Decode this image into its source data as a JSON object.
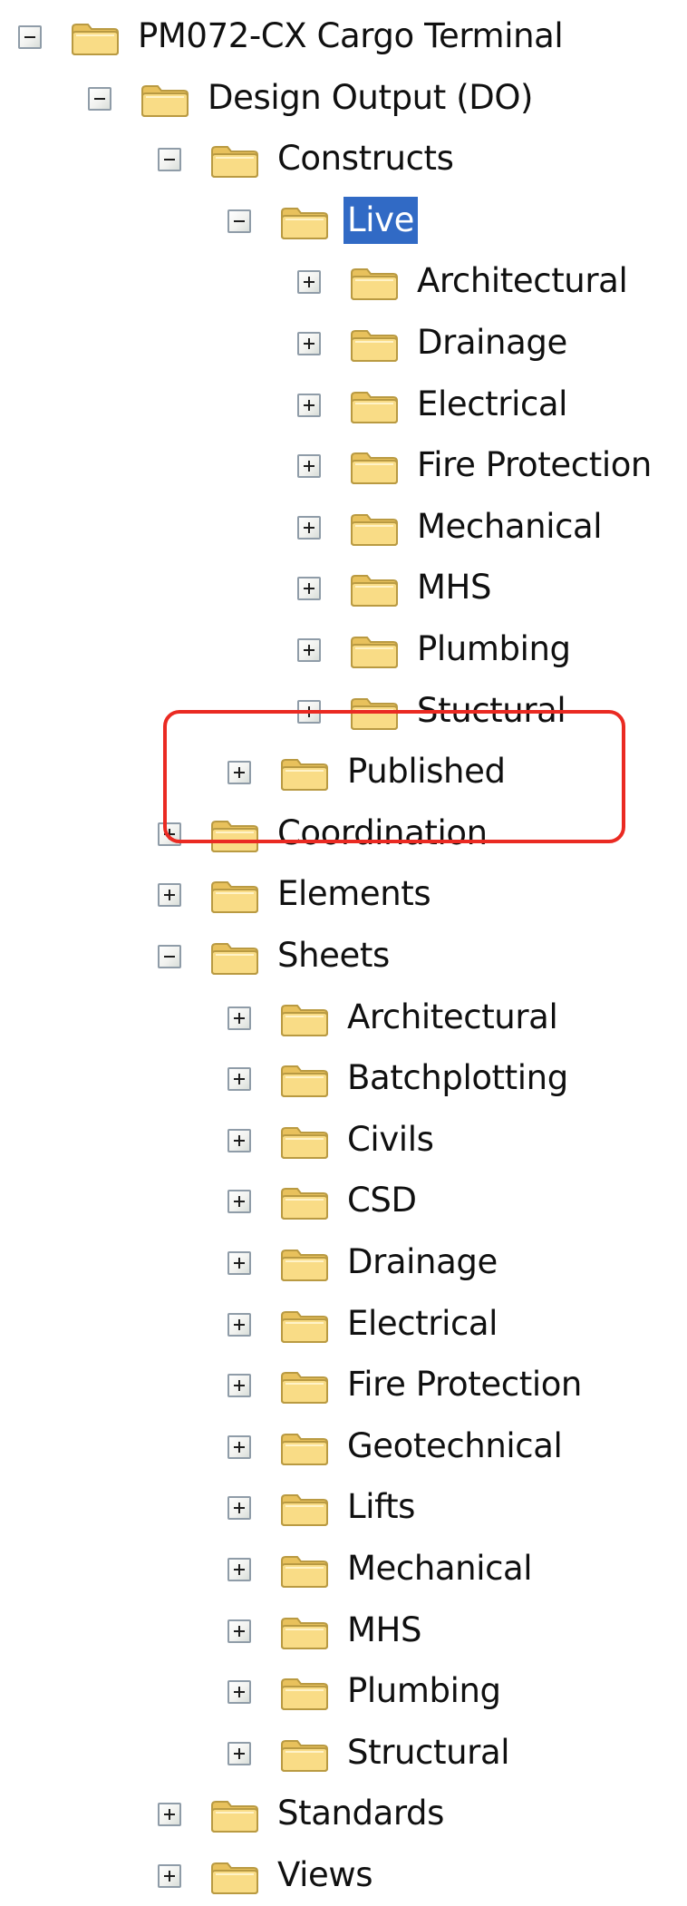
{
  "tree": [
    {
      "label": "PM072-CX Cargo Terminal",
      "level": 0,
      "expanded": true
    },
    {
      "label": "Design Output (DO)",
      "level": 1,
      "expanded": true
    },
    {
      "label": "Constructs",
      "level": 2,
      "expanded": true
    },
    {
      "label": "Live",
      "level": 3,
      "expanded": true,
      "selected": true
    },
    {
      "label": "Architectural",
      "level": 4,
      "expanded": false
    },
    {
      "label": "Drainage",
      "level": 4,
      "expanded": false
    },
    {
      "label": "Electrical",
      "level": 4,
      "expanded": false
    },
    {
      "label": "Fire Protection",
      "level": 4,
      "expanded": false
    },
    {
      "label": "Mechanical",
      "level": 4,
      "expanded": false
    },
    {
      "label": "MHS",
      "level": 4,
      "expanded": false
    },
    {
      "label": "Plumbing",
      "level": 4,
      "expanded": false
    },
    {
      "label": "Stuctural",
      "level": 4,
      "expanded": false
    },
    {
      "label": "Published",
      "level": 3,
      "expanded": false
    },
    {
      "label": "Coordination",
      "level": 2,
      "expanded": false
    },
    {
      "label": "Elements",
      "level": 2,
      "expanded": false
    },
    {
      "label": "Sheets",
      "level": 2,
      "expanded": true
    },
    {
      "label": "Architectural",
      "level": 3,
      "expanded": false
    },
    {
      "label": "Batchplotting",
      "level": 3,
      "expanded": false
    },
    {
      "label": "Civils",
      "level": 3,
      "expanded": false
    },
    {
      "label": "CSD",
      "level": 3,
      "expanded": false
    },
    {
      "label": "Drainage",
      "level": 3,
      "expanded": false
    },
    {
      "label": "Electrical",
      "level": 3,
      "expanded": false
    },
    {
      "label": "Fire Protection",
      "level": 3,
      "expanded": false
    },
    {
      "label": "Geotechnical",
      "level": 3,
      "expanded": false
    },
    {
      "label": "Lifts",
      "level": 3,
      "expanded": false
    },
    {
      "label": "Mechanical",
      "level": 3,
      "expanded": false
    },
    {
      "label": "MHS",
      "level": 3,
      "expanded": false
    },
    {
      "label": "Plumbing",
      "level": 3,
      "expanded": false
    },
    {
      "label": "Structural",
      "level": 3,
      "expanded": false
    },
    {
      "label": "Standards",
      "level": 2,
      "expanded": false
    },
    {
      "label": "Views",
      "level": 2,
      "expanded": false
    }
  ],
  "icons": {
    "folder": "folder-icon",
    "expand": "plus-box-icon",
    "collapse": "minus-box-icon"
  },
  "colors": {
    "selection": "#316ac5",
    "highlight_border": "#ea2a22",
    "folder_body": "#f6d67e",
    "folder_outline": "#b99a42"
  }
}
